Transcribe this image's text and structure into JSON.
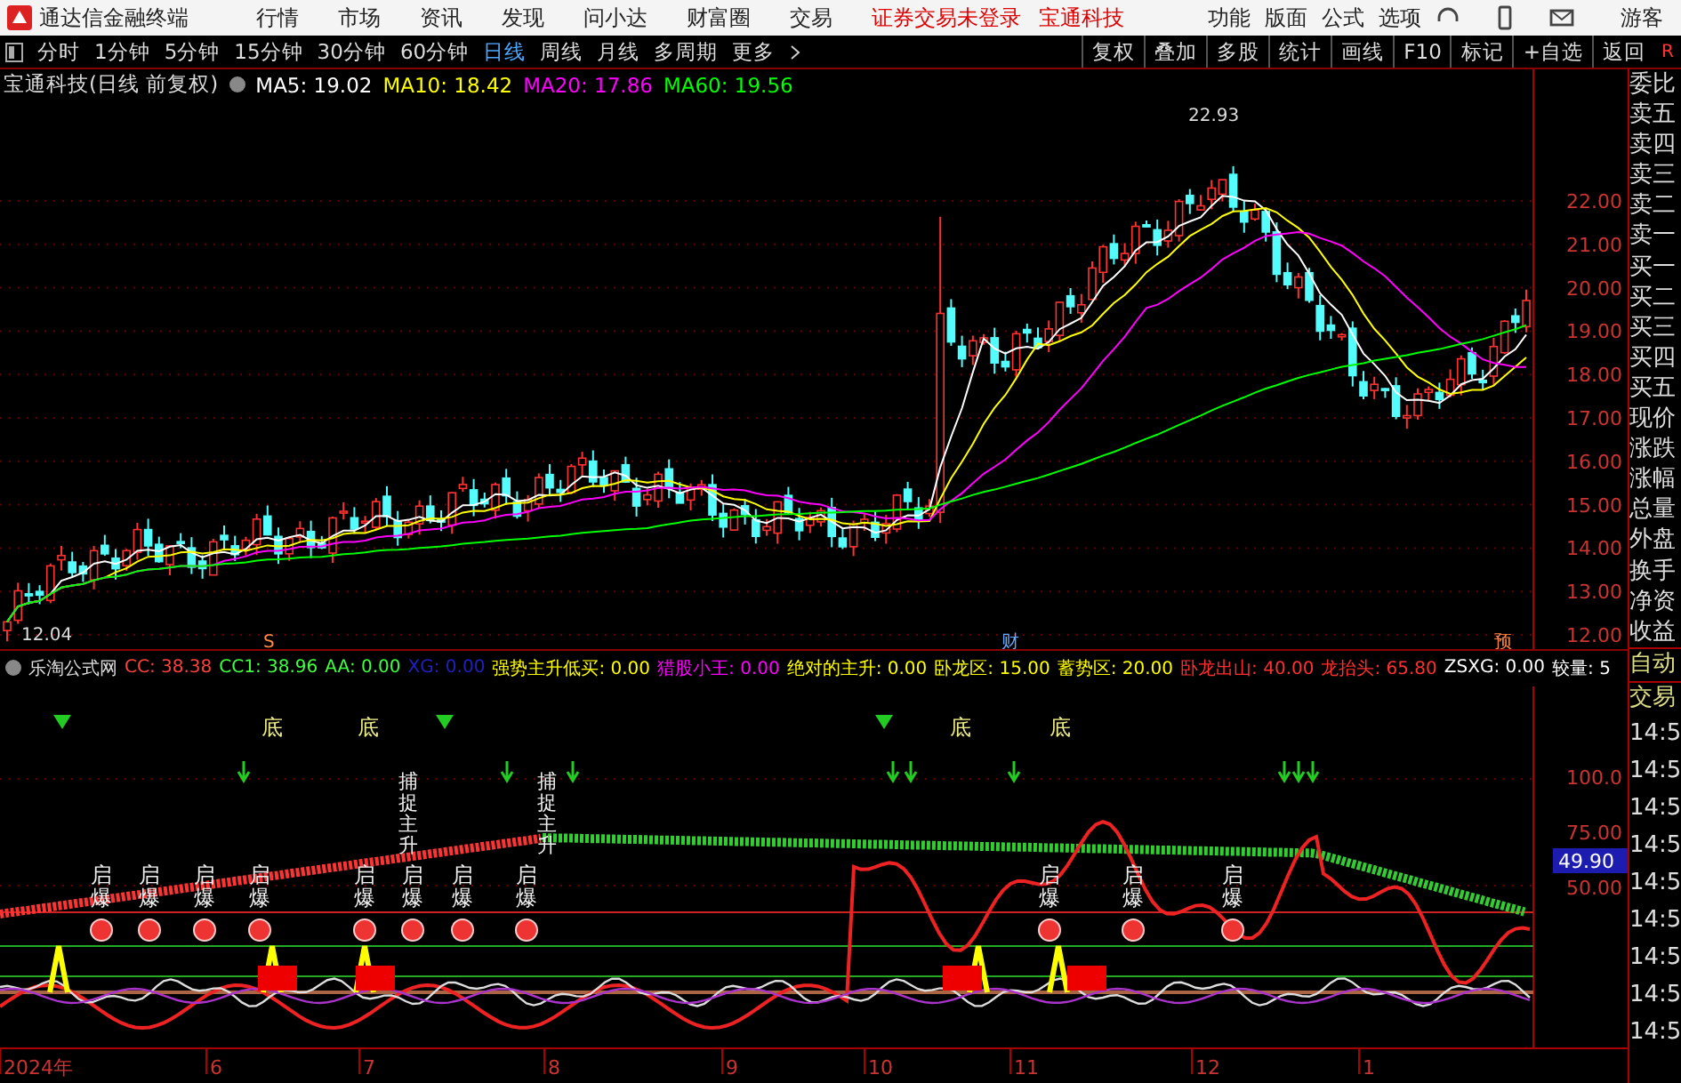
{
  "app": {
    "title": "通达信金融终端"
  },
  "menu": [
    "行情",
    "市场",
    "资讯",
    "发现",
    "问小达",
    "财富圈",
    "交易"
  ],
  "notices": [
    "证券交易未登录",
    "宝通科技"
  ],
  "right_menu": [
    "功能",
    "版面",
    "公式",
    "选项"
  ],
  "user": "游客",
  "periods": [
    {
      "label": "分时",
      "selected": false
    },
    {
      "label": "1分钟",
      "selected": false
    },
    {
      "label": "5分钟",
      "selected": false
    },
    {
      "label": "15分钟",
      "selected": false
    },
    {
      "label": "30分钟",
      "selected": false
    },
    {
      "label": "60分钟",
      "selected": false
    },
    {
      "label": "日线",
      "selected": true
    },
    {
      "label": "周线",
      "selected": false
    },
    {
      "label": "月线",
      "selected": false
    },
    {
      "label": "多周期",
      "selected": false
    }
  ],
  "more": "更多",
  "tools": [
    "复权",
    "叠加",
    "多股",
    "统计",
    "画线",
    "F10",
    "标记",
    "+自选",
    "返回"
  ],
  "corner": "R",
  "price_chart": {
    "stock": "宝通科技(日线 前复权)",
    "mas": [
      {
        "label": "MA5: 19.02",
        "color": "#ffffff"
      },
      {
        "label": "MA10: 18.42",
        "color": "#ffff00"
      },
      {
        "label": "MA20: 17.86",
        "color": "#ff00ff"
      },
      {
        "label": "MA60: 19.56",
        "color": "#00ff00"
      }
    ],
    "high_label": "22.93",
    "low_label": "12.04",
    "y_ticks": [
      "22.00",
      "21.00",
      "20.00",
      "19.00",
      "18.00",
      "17.00",
      "16.00",
      "15.00",
      "14.00",
      "13.00",
      "12.00"
    ],
    "markers": [
      "S",
      "财",
      "预"
    ]
  },
  "indicator": {
    "name": "乐淘公式网",
    "values": [
      {
        "text": "CC: 38.38",
        "color": "#ff4040"
      },
      {
        "text": "CC1: 38.96",
        "color": "#40ff40"
      },
      {
        "text": "AA: 0.00",
        "color": "#40ff40"
      },
      {
        "text": "XG: 0.00",
        "color": "#2020c0"
      },
      {
        "text": "强势主升低买: 0.00",
        "color": "#ffff00"
      },
      {
        "text": "猎股小王: 0.00",
        "color": "#ff00ff"
      },
      {
        "text": "绝对的主升: 0.00",
        "color": "#ffff00"
      },
      {
        "text": "卧龙区: 15.00",
        "color": "#ffff00"
      },
      {
        "text": "蓄势区: 20.00",
        "color": "#ffff00"
      },
      {
        "text": "卧龙出山: 40.00",
        "color": "#ff3030"
      },
      {
        "text": "龙抬头: 65.80",
        "color": "#ff3030"
      },
      {
        "text": "ZSXG: 0.00",
        "color": "#ffffff"
      },
      {
        "text": "较量: 5",
        "color": "#ffffff"
      }
    ],
    "y_ticks": [
      "100.0",
      "75.00",
      "50.00"
    ],
    "current": "49.90",
    "qibao_labels": [
      "启爆",
      "启爆",
      "启爆",
      "启爆",
      "启爆",
      "启爆",
      "启爆",
      "启爆",
      "启爆",
      "启爆",
      "启爆"
    ],
    "bottom_labels": [
      "底",
      "底",
      "底",
      "底"
    ],
    "capture_labels": [
      "捕捉主升",
      "捕捉主升"
    ]
  },
  "x_axis": [
    "2024年",
    "6",
    "7",
    "8",
    "9",
    "10",
    "11",
    "12",
    "1"
  ],
  "quote_panel": {
    "labels": [
      "委比",
      "卖五",
      "卖四",
      "卖三",
      "卖二",
      "卖一",
      "买一",
      "买二",
      "买三",
      "买四",
      "买五",
      "现价",
      "涨跌",
      "涨幅",
      "总量",
      "外盘",
      "换手",
      "净资",
      "收益"
    ],
    "auto": [
      "自动",
      "交易"
    ],
    "times": [
      "14:5",
      "14:5",
      "14:5",
      "14:5",
      "14:5",
      "14:5",
      "14:5",
      "14:5",
      "14:5"
    ]
  }
}
